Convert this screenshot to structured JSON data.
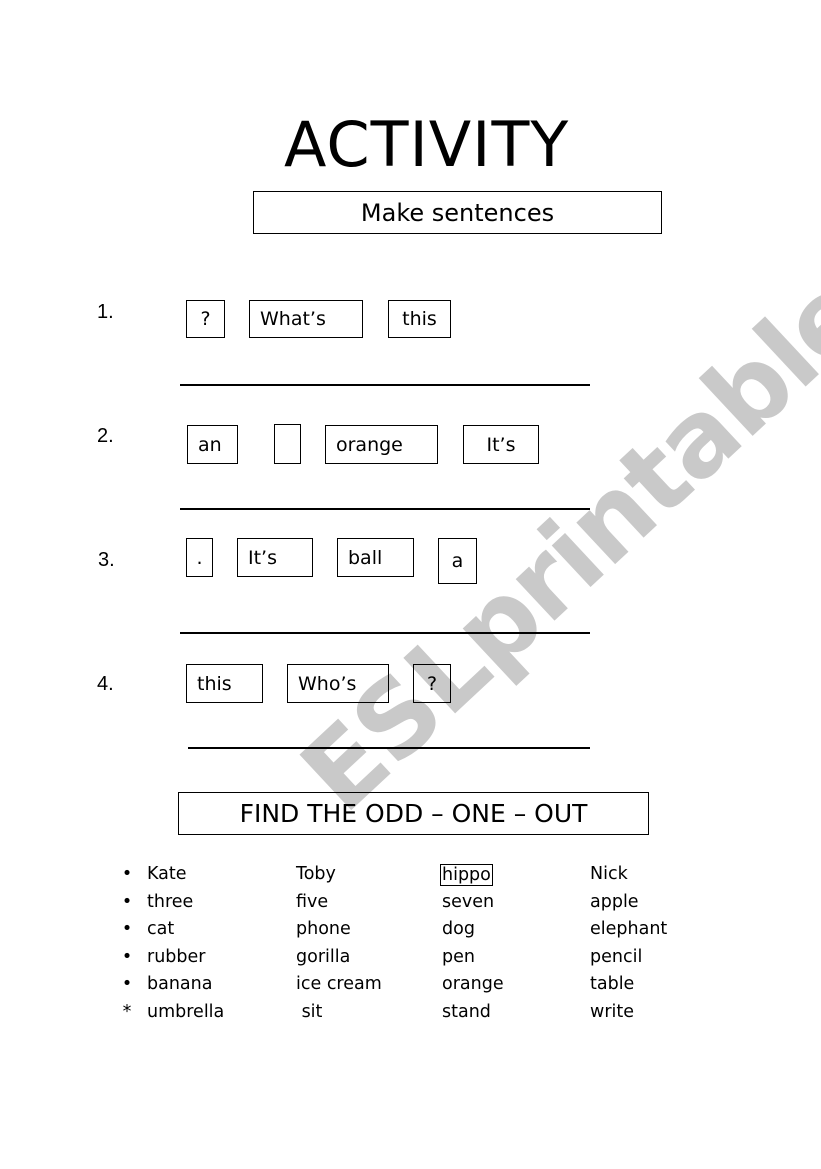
{
  "watermark": "ESLprintables.com",
  "title": "ACTIVITY",
  "section1": {
    "heading": "Make sentences",
    "items": [
      {
        "number": "1.",
        "words": [
          "?",
          "What’s",
          "this"
        ]
      },
      {
        "number": "2.",
        "words": [
          "an",
          "",
          "orange",
          "It’s"
        ]
      },
      {
        "number": "3.",
        "words": [
          ".",
          "It’s",
          "ball",
          "a"
        ]
      },
      {
        "number": "4.",
        "words": [
          "this",
          "Who’s",
          "?"
        ]
      }
    ]
  },
  "section2": {
    "heading": "FIND THE ODD – ONE – OUT",
    "rows": [
      {
        "marker": "•",
        "words": [
          "Kate",
          "Toby",
          "hippo",
          "Nick"
        ],
        "marked_index": 2
      },
      {
        "marker": "•",
        "words": [
          "three",
          "five",
          "seven",
          "apple"
        ]
      },
      {
        "marker": "•",
        "words": [
          "cat",
          "phone",
          "dog",
          "elephant"
        ]
      },
      {
        "marker": "•",
        "words": [
          "rubber",
          "gorilla",
          "pen",
          "pencil"
        ]
      },
      {
        "marker": "•",
        "words": [
          "banana",
          "ice cream",
          "orange",
          "table"
        ]
      },
      {
        "marker": "*",
        "words": [
          "umbrella",
          " sit",
          "stand",
          "write"
        ]
      }
    ]
  }
}
